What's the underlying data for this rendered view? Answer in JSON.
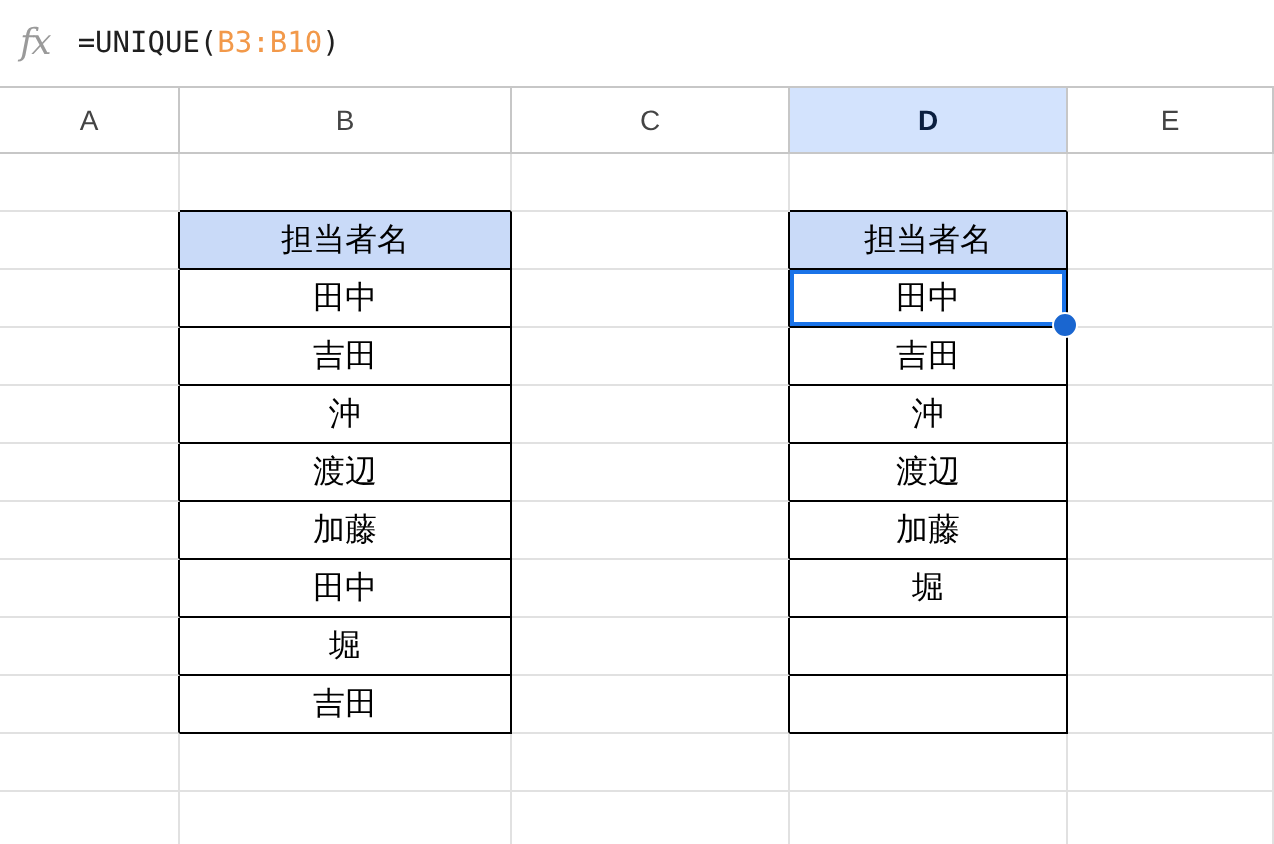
{
  "formula_bar": {
    "icon": "fx",
    "formula": [
      {
        "kind": "plain",
        "text": "=UNIQUE("
      },
      {
        "kind": "ref",
        "text": "B3:B10"
      },
      {
        "kind": "plain",
        "text": ")"
      }
    ]
  },
  "columns": [
    {
      "label": "A",
      "selected": false
    },
    {
      "label": "B",
      "selected": false
    },
    {
      "label": "C",
      "selected": false
    },
    {
      "label": "D",
      "selected": true
    },
    {
      "label": "E",
      "selected": false
    }
  ],
  "tables": [
    {
      "header": "担当者名",
      "rows": [
        {
          "text": "田中",
          "selected": false
        },
        {
          "text": "吉田",
          "selected": false
        },
        {
          "text": "沖",
          "selected": false
        },
        {
          "text": "渡辺",
          "selected": false
        },
        {
          "text": "加藤",
          "selected": false
        },
        {
          "text": "田中",
          "selected": false
        },
        {
          "text": "堀",
          "selected": false
        },
        {
          "text": "吉田",
          "selected": false
        }
      ]
    },
    {
      "header": "担当者名",
      "rows": [
        {
          "text": "田中",
          "selected": true
        },
        {
          "text": "吉田",
          "selected": false
        },
        {
          "text": "沖",
          "selected": false
        },
        {
          "text": "渡辺",
          "selected": false
        },
        {
          "text": "加藤",
          "selected": false
        },
        {
          "text": "堀",
          "selected": false
        },
        {
          "selected": false
        },
        {
          "selected": false
        }
      ]
    }
  ]
}
